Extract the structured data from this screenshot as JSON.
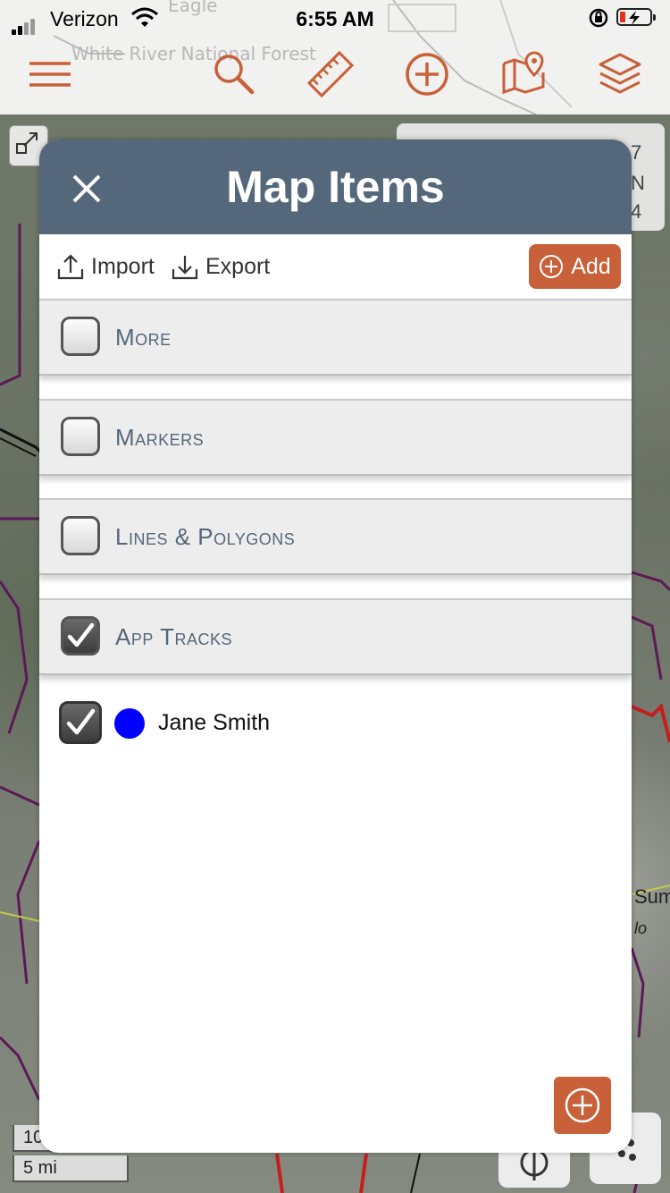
{
  "status_bar": {
    "carrier": "Verizon",
    "time": "6:55 AM"
  },
  "map": {
    "label_top": "Eagle",
    "label_forest": "White River National Forest",
    "side_text_right": [
      "7",
      "N",
      "4"
    ],
    "label_sum": "Sum",
    "label_lo": "lo",
    "scale_top": "10",
    "scale_bottom": "5 mi"
  },
  "toolbar": {
    "icons": [
      "menu-icon",
      "search-icon",
      "ruler-icon",
      "add-circle-icon",
      "map-marker-icon",
      "layers-icon"
    ],
    "accent_color": "#c8603a"
  },
  "modal": {
    "title": "Map Items",
    "header_color": "#55677a",
    "import_label": "Import",
    "export_label": "Export",
    "add_label": "Add",
    "sections": [
      {
        "label": "More",
        "checked": false
      },
      {
        "label": "Markers",
        "checked": false
      },
      {
        "label": "Lines & Polygons",
        "checked": false
      },
      {
        "label": "App Tracks",
        "checked": true
      }
    ],
    "tracks": [
      {
        "name": "Jane Smith",
        "checked": true,
        "color": "#0000ff"
      }
    ]
  }
}
